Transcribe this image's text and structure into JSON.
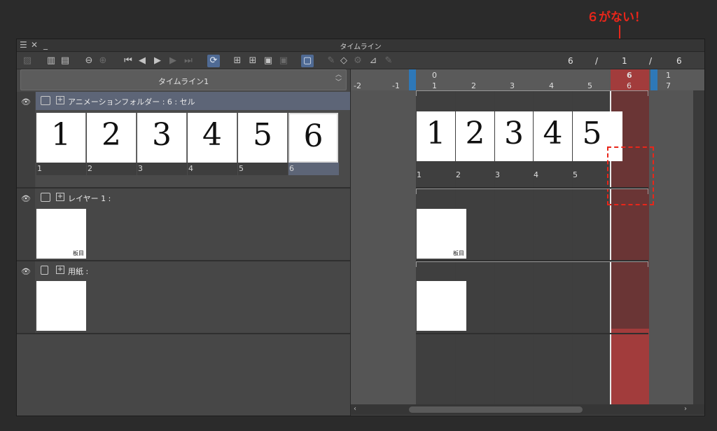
{
  "annotation": {
    "text": "６がない！",
    "color": "#e8261a"
  },
  "window": {
    "title": "タイムライン"
  },
  "toolbar": {
    "frame_current": "6",
    "sep1": "/",
    "frame_start": "1",
    "sep2": "/",
    "frame_total": "6"
  },
  "timeline": {
    "name": "タイムライン1"
  },
  "layers": [
    {
      "name": "アニメーションフォルダー : 6 : セル",
      "cells": [
        "1",
        "2",
        "3",
        "4",
        "5",
        "6"
      ],
      "cell_labels": [
        "1",
        "2",
        "3",
        "4",
        "5",
        "6"
      ]
    },
    {
      "name": "レイヤー 1 :",
      "cell_text": "板目"
    },
    {
      "name": "用紙 :"
    }
  ],
  "ruler": {
    "neg": [
      "-2",
      "-1"
    ],
    "top": [
      "0",
      "6",
      "1"
    ],
    "bottom": [
      "1",
      "2",
      "3",
      "4",
      "5",
      "6",
      "7"
    ]
  },
  "track": {
    "cells": [
      "1",
      "2",
      "3",
      "4",
      "5"
    ],
    "cell_labels": [
      "1",
      "2",
      "3",
      "4",
      "5"
    ],
    "layer2_cell_text": "板目"
  },
  "colors": {
    "accent": "#4f6a94",
    "current_frame": "#a23c3c",
    "marker": "#2e78b8"
  }
}
